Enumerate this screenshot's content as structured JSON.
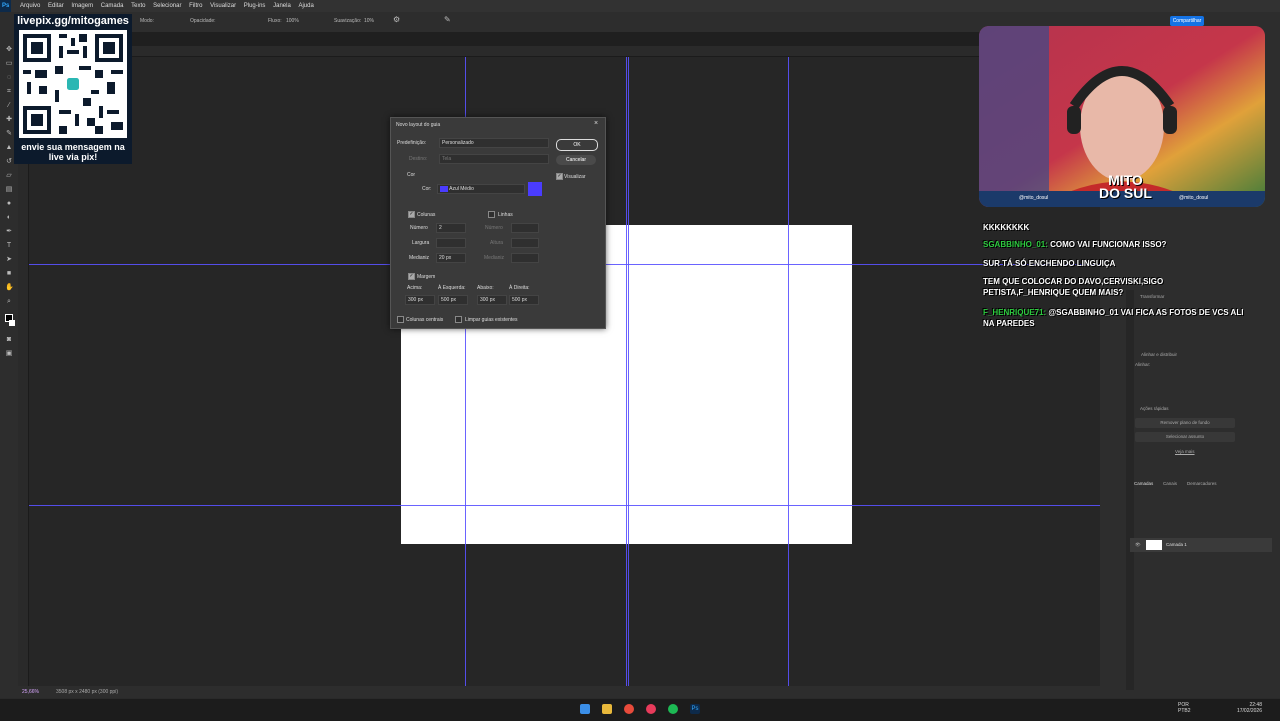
{
  "menu": {
    "logo": "Ps",
    "items": [
      "Arquivo",
      "Editar",
      "Imagem",
      "Camada",
      "Texto",
      "Selecionar",
      "Filtro",
      "Visualizar",
      "Plug-ins",
      "Janela",
      "Ajuda"
    ]
  },
  "options": {
    "mode_label": "Modo:",
    "opacity_label": "Opacidade:",
    "flow_label": "Fluxo:",
    "flow_value": "100%",
    "smoothing_label": "Suavização:",
    "smoothing_value": "10%",
    "share": "Compartilhar"
  },
  "overlay": {
    "url": "livepix.gg/mitogames",
    "message": "envie sua mensagem na live via pix!"
  },
  "webcam": {
    "brand_line1": "MITO",
    "brand_line2": "DO SUL",
    "handle_left": "@mito_dosul",
    "handle_right": "@mito_dosul"
  },
  "chat": [
    {
      "user": "",
      "text": "KKKKKKKK"
    },
    {
      "user": "SGABBINHO_01:",
      "text": "COMO VAI FUNCIONAR ISSO?"
    },
    {
      "user": "",
      "text": "SUR TÁ SÓ ENCHENDO LINGUIÇA"
    },
    {
      "user": "",
      "text": "TEM QUE COLOCAR DO DAVO,CERVISKI,SIGO PETISTA,F_HENRIQUE QUEM MAIS?"
    },
    {
      "user": "F_HENRIQUE71:",
      "text": "@SGABBINHO_01 VAI FICA AS FOTOS DE VCS ALI NA PAREDES"
    }
  ],
  "dialog": {
    "title": "Novo layout do guia",
    "preset_label": "Predefinição:",
    "preset_value": "Personalizado",
    "target_label": "Destino:",
    "target_value": "Tela",
    "color_section": "Cor",
    "color_label": "Cor:",
    "color_value": "Azul Médio",
    "color_hex": "#4a3cff",
    "ok": "OK",
    "cancel": "Cancelar",
    "preview": "Visualizar",
    "columns": "Colunas",
    "rows": "Linhas",
    "number_label": "Número",
    "number_value": "2",
    "width_label": "Largura",
    "gutter_label": "Medianiz",
    "gutter_value": "20 px",
    "rows_number_label": "Número",
    "rows_height_label": "Altura",
    "rows_gutter_label": "Medianiz",
    "margin": "Margem",
    "top_label": "Acima:",
    "left_label": "À Esquerda:",
    "bottom_label": "Abaixo:",
    "right_label": "À Direita:",
    "top_value": "300 px",
    "left_value": "500 px",
    "bottom_value": "300 px",
    "right_value": "500 px",
    "center_columns": "Colunas centrais",
    "clear_guides": "Limpar guias existentes"
  },
  "panels": {
    "transform": "Transformar",
    "align": "Alinhar e distribuir",
    "align_sub": "Alinhar:",
    "quick_actions": "Ações rápidas",
    "remove_bg": "Remover plano de fundo",
    "select_subject": "Selecionar assunto",
    "see_more": "Veja mais",
    "tabs": [
      "Camadas",
      "Canais",
      "Demarcadores"
    ],
    "layer_name": "Camada 1"
  },
  "status": {
    "zoom": "25,66%",
    "doc_size": "3508 px x 2480 px (300 ppi)"
  },
  "taskbar": {
    "lang1": "POR",
    "lang2": "PTB2",
    "time": "22:48",
    "date": "17/02/2026"
  }
}
